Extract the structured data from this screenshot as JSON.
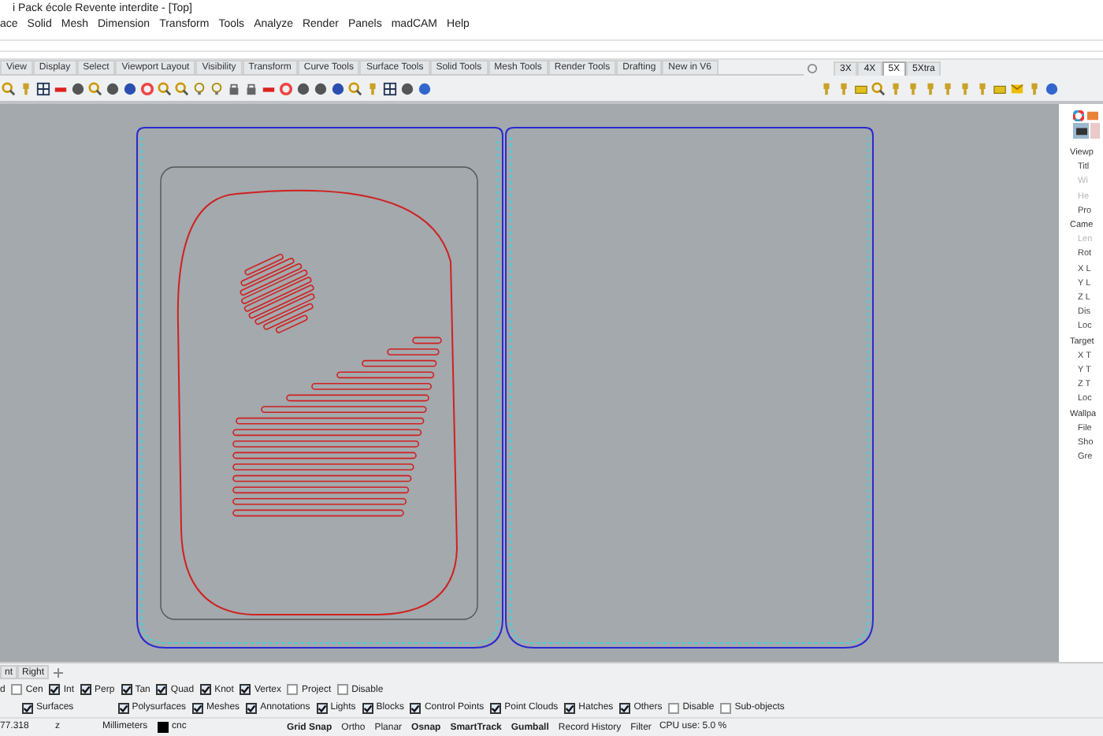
{
  "window": {
    "title": "i Pack école Revente interdite - [Top]"
  },
  "menu": [
    "ace",
    "Solid",
    "Mesh",
    "Dimension",
    "Transform",
    "Tools",
    "Analyze",
    "Render",
    "Panels",
    "madCAM",
    "Help"
  ],
  "toolbar_tabs": [
    {
      "label": "View",
      "selected": false
    },
    {
      "label": "Display",
      "selected": false
    },
    {
      "label": "Select",
      "selected": false
    },
    {
      "label": "Viewport Layout",
      "selected": false
    },
    {
      "label": "Visibility",
      "selected": false
    },
    {
      "label": "Transform",
      "selected": false
    },
    {
      "label": "Curve Tools",
      "selected": false
    },
    {
      "label": "Surface Tools",
      "selected": false
    },
    {
      "label": "Solid Tools",
      "selected": false
    },
    {
      "label": "Mesh Tools",
      "selected": false
    },
    {
      "label": "Render Tools",
      "selected": false
    },
    {
      "label": "Drafting",
      "selected": false
    },
    {
      "label": "New in V6",
      "selected": false
    }
  ],
  "side_tabs": [
    {
      "label": "3X",
      "selected": false
    },
    {
      "label": "4X",
      "selected": false
    },
    {
      "label": "5X",
      "selected": true
    },
    {
      "label": "5Xtra",
      "selected": false
    }
  ],
  "properties": [
    {
      "kind": "heading",
      "label": "Viewp"
    },
    {
      "kind": "item",
      "label": "Titl",
      "disabled": false
    },
    {
      "kind": "item",
      "label": "Wi",
      "disabled": true
    },
    {
      "kind": "item",
      "label": "He",
      "disabled": true
    },
    {
      "kind": "item",
      "label": "Pro",
      "disabled": false
    },
    {
      "kind": "heading",
      "label": "Came"
    },
    {
      "kind": "item",
      "label": "Len",
      "disabled": true
    },
    {
      "kind": "item",
      "label": "Rot",
      "disabled": false
    },
    {
      "kind": "item",
      "label": "X L",
      "disabled": false
    },
    {
      "kind": "item",
      "label": "Y L",
      "disabled": false
    },
    {
      "kind": "item",
      "label": "Z L",
      "disabled": false
    },
    {
      "kind": "item",
      "label": "Dis",
      "disabled": false
    },
    {
      "kind": "item",
      "label": "Loc",
      "disabled": false
    },
    {
      "kind": "heading",
      "label": "Target"
    },
    {
      "kind": "item",
      "label": "X T",
      "disabled": false
    },
    {
      "kind": "item",
      "label": "Y T",
      "disabled": false
    },
    {
      "kind": "item",
      "label": "Z T",
      "disabled": false
    },
    {
      "kind": "item",
      "label": "Loc",
      "disabled": false
    },
    {
      "kind": "heading",
      "label": "Wallpa"
    },
    {
      "kind": "item",
      "label": "File",
      "disabled": false
    },
    {
      "kind": "item",
      "label": "Sho",
      "disabled": false
    },
    {
      "kind": "item",
      "label": "Gre",
      "disabled": false
    }
  ],
  "viewport_tabs": [
    {
      "label": "nt",
      "selected": false
    },
    {
      "label": "Right",
      "selected": false
    }
  ],
  "osnaps": [
    {
      "kind": "cut",
      "label": "d"
    },
    {
      "kind": "check",
      "label": "Cen",
      "checked": false
    },
    {
      "kind": "check",
      "label": "Int",
      "checked": true
    },
    {
      "kind": "check",
      "label": "Perp",
      "checked": true
    },
    {
      "kind": "check",
      "label": "Tan",
      "checked": true
    },
    {
      "kind": "check",
      "label": "Quad",
      "checked": true
    },
    {
      "kind": "check",
      "label": "Knot",
      "checked": true
    },
    {
      "kind": "check",
      "label": "Vertex",
      "checked": true
    },
    {
      "kind": "check",
      "label": "Project",
      "checked": false
    },
    {
      "kind": "check",
      "label": "Disable",
      "checked": false
    }
  ],
  "selection_filter": [
    {
      "label": "Surfaces",
      "checked": true
    },
    {
      "label": "Polysurfaces",
      "checked": true
    },
    {
      "label": "Meshes",
      "checked": true
    },
    {
      "label": "Annotations",
      "checked": true
    },
    {
      "label": "Lights",
      "checked": true
    },
    {
      "label": "Blocks",
      "checked": true
    },
    {
      "label": "Control Points",
      "checked": true
    },
    {
      "label": "Point Clouds",
      "checked": true
    },
    {
      "label": "Hatches",
      "checked": true
    },
    {
      "label": "Others",
      "checked": true
    },
    {
      "label": "Disable",
      "checked": false
    },
    {
      "label": "Sub-objects",
      "checked": false
    }
  ],
  "status_bar": {
    "coordinate": "77.318",
    "axis": "z",
    "units": "Millimeters",
    "layer": "cnc",
    "panes": [
      {
        "label": "Grid Snap",
        "on": true
      },
      {
        "label": "Ortho",
        "on": false
      },
      {
        "label": "Planar",
        "on": false
      },
      {
        "label": "Osnap",
        "on": true
      },
      {
        "label": "SmartTrack",
        "on": true
      },
      {
        "label": "Gumball",
        "on": true
      },
      {
        "label": "Record History",
        "on": false
      },
      {
        "label": "Filter",
        "on": false
      }
    ],
    "cpu": "CPU use: 5.0 %"
  }
}
